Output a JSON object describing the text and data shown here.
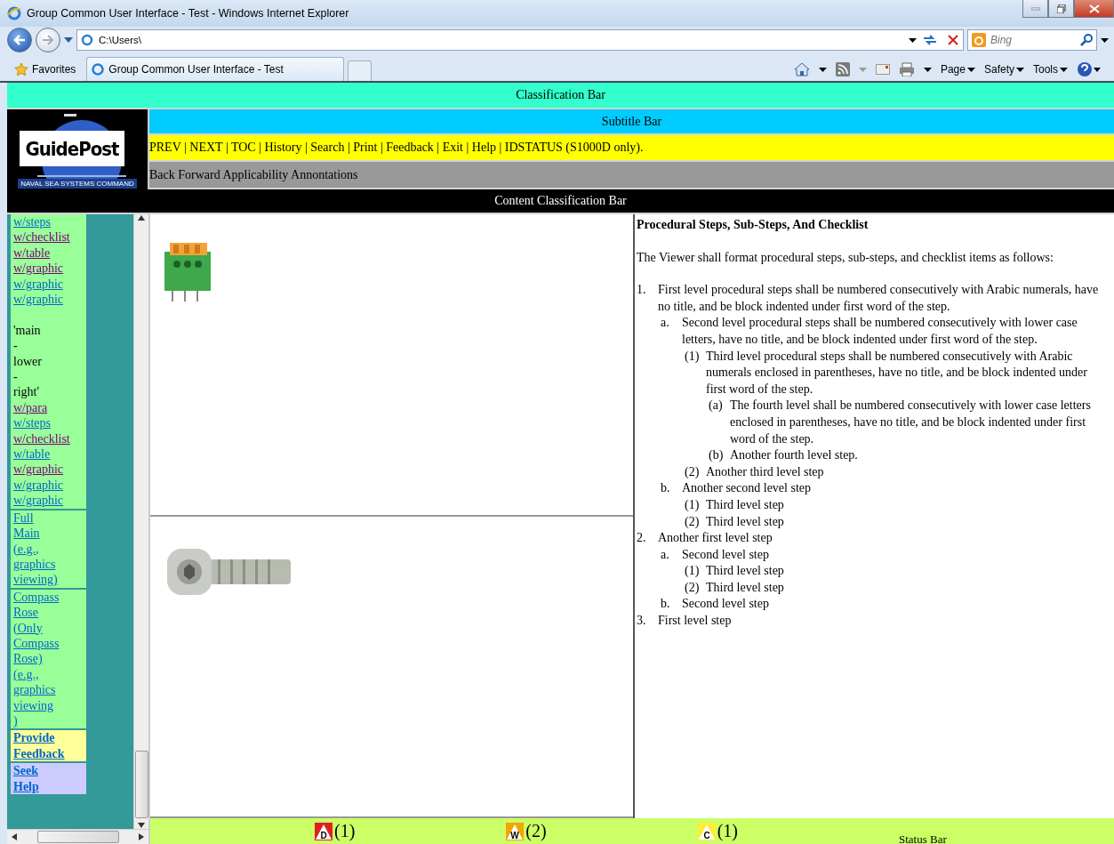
{
  "browser": {
    "title": "Group Common User Interface - Test - Windows Internet Explorer",
    "address": "C:\\Users\\",
    "search_placeholder": "Bing",
    "favorites": "Favorites",
    "tab": "Group Common User Interface - Test",
    "menus": [
      "Page",
      "Safety",
      "Tools"
    ]
  },
  "classification_bar": "Classification Bar",
  "logo": {
    "name": "GuidePost",
    "caption": "NAVAL SEA SYSTEMS COMMAND"
  },
  "subtitle_bar": "Subtitle Bar",
  "nav_bar": "PREV | NEXT | TOC | History | Search | Print | Feedback | Exit | Help | IDSTATUS (S1000D only).",
  "tool_bar": "Back Forward Applicability Annontations",
  "content_classification_bar": "Content Classification Bar",
  "sidebar": [
    {
      "kind": "green",
      "items": [
        {
          "kind": "link",
          "text": "w/steps",
          "visited": false
        },
        {
          "kind": "link",
          "text": "w/checklist",
          "visited": true
        },
        {
          "kind": "link",
          "text": "w/table",
          "visited": true
        },
        {
          "kind": "link",
          "text": "w/graphic",
          "visited": true
        },
        {
          "kind": "link",
          "text": "w/graphic",
          "visited": false
        },
        {
          "kind": "link",
          "text": "w/graphic",
          "visited": false
        },
        {
          "kind": "gap"
        },
        {
          "kind": "text",
          "text": "'main"
        },
        {
          "kind": "text",
          "text": "-"
        },
        {
          "kind": "text",
          "text": "lower"
        },
        {
          "kind": "text",
          "text": "-"
        },
        {
          "kind": "text",
          "text": "right'"
        },
        {
          "kind": "link",
          "text": "w/para",
          "visited": true
        },
        {
          "kind": "link",
          "text": "w/steps",
          "visited": false
        },
        {
          "kind": "link",
          "text": "w/checklist",
          "visited": true
        },
        {
          "kind": "link",
          "text": "w/table",
          "visited": false
        },
        {
          "kind": "link",
          "text": "w/graphic",
          "visited": true
        },
        {
          "kind": "link",
          "text": "w/graphic",
          "visited": false
        },
        {
          "kind": "link",
          "text": "w/graphic",
          "visited": false
        }
      ]
    },
    {
      "kind": "green",
      "items": [
        {
          "kind": "link",
          "text": "Full Main (e.g., graphics viewing)",
          "visited": false
        }
      ]
    },
    {
      "kind": "green",
      "items": [
        {
          "kind": "link",
          "text": "Compass Rose (Only Compass Rose) (e.g., graphics viewing )",
          "visited": false
        }
      ]
    },
    {
      "kind": "yellow",
      "items": [
        {
          "kind": "bold",
          "text": "Provide Feedback",
          "visited": false
        }
      ]
    },
    {
      "kind": "lavender",
      "items": [
        {
          "kind": "bold",
          "text": "Seek Help",
          "visited": false
        }
      ]
    }
  ],
  "content": {
    "title": "Procedural Steps, Sub-Steps, And Checklist",
    "intro": "The Viewer shall format procedural steps, sub-steps, and checklist items as follows:",
    "steps": [
      {
        "marker": "1.",
        "text": "First level procedural steps shall be numbered consecutively with Arabic numerals, have no title, and be block indented under first word of the step.",
        "children": [
          {
            "marker": "a.",
            "text": "Second level procedural steps shall be numbered consecutively with lower case letters, have no title, and be block indented under first word of the step.",
            "children": [
              {
                "marker": "(1)",
                "text": "Third level procedural steps shall be numbered consecutively with Arabic numerals enclosed in parentheses, have no title, and be block indented under first word of the step.",
                "children": [
                  {
                    "marker": "(a)",
                    "text": "The fourth level shall be numbered consecutively with lower case letters enclosed in parentheses, have no title, and be block indented under first word of the step."
                  },
                  {
                    "marker": "(b)",
                    "text": "Another fourth level step."
                  }
                ]
              },
              {
                "marker": "(2)",
                "text": "Another third level step"
              }
            ]
          },
          {
            "marker": "b.",
            "text": "Another second level step",
            "children": [
              {
                "marker": "(1)",
                "text": "Third level step"
              },
              {
                "marker": "(2)",
                "text": "Third level step"
              }
            ]
          }
        ]
      },
      {
        "marker": "2.",
        "text": "Another first level step",
        "children": [
          {
            "marker": "a.",
            "text": "Second level step",
            "children": [
              {
                "marker": "(1)",
                "text": "Third level step"
              },
              {
                "marker": "(2)",
                "text": "Third level step"
              }
            ]
          },
          {
            "marker": "b.",
            "text": "Second level step"
          }
        ]
      },
      {
        "marker": "3.",
        "text": "First level step"
      }
    ]
  },
  "status_bar": {
    "indicators": [
      {
        "kind": "danger",
        "letter": "D",
        "count": "(1)"
      },
      {
        "kind": "warning",
        "letter": "W",
        "count": "(2)"
      },
      {
        "kind": "caution",
        "letter": "C",
        "count": "(1)"
      }
    ],
    "label": "Status Bar"
  }
}
